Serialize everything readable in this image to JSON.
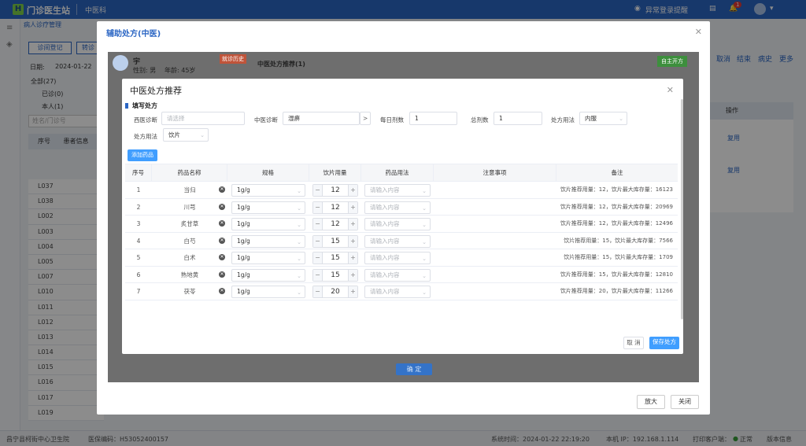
{
  "topbar": {
    "app_title": "门诊医生站",
    "department": "中医科",
    "anomaly_alert": "异常登录提醒",
    "notification_count": "1"
  },
  "background": {
    "breadcrumb": "病人诊疗管理",
    "register_button": "诊间登记",
    "transfer_button": "转诊",
    "date_label": "日期:",
    "date_value": "2024-01-22",
    "filter_all": "全部(27)",
    "filter_done": "已诊(0)",
    "filter_self": "本人(1)",
    "search_placeholder": "姓名/门诊号",
    "table_headers": [
      "序号",
      "患者信息"
    ],
    "rows": [
      "L037",
      "L038",
      "L002",
      "L003",
      "L004",
      "L005",
      "L007",
      "L010",
      "L011",
      "L012",
      "L013",
      "L014",
      "L015",
      "L016",
      "L017",
      "L019"
    ],
    "patient_name": "宇",
    "patient_gender": "性别: 男",
    "patient_age": "年龄: 45岁",
    "history_badge": "就诊历史",
    "recommend_title": "中医处方推荐(1)",
    "self_prescribe": "自主开方",
    "right_actions": [
      "取消",
      "结束",
      "病史",
      "更多"
    ],
    "op_header": "操作",
    "op_links": [
      "复用",
      "复用"
    ]
  },
  "outer_dialog": {
    "title": "辅助处方(中医)",
    "confirm_button": "确 定",
    "maximize_button": "放大",
    "close_button": "关闭"
  },
  "inner_dialog": {
    "title": "中医处方推荐",
    "section_title": "填写处方",
    "form": {
      "western_diag_label": "西医诊断",
      "western_diag_placeholder": "请选择",
      "tcm_diag_label": "中医诊断",
      "tcm_diag_value": "湿痹",
      "daily_doses_label": "每日剂数",
      "daily_doses_value": "1",
      "total_doses_label": "总剂数",
      "total_doses_value": "1",
      "usage_label": "处方用法",
      "usage_value": "内服",
      "usage2_label": "处方用法",
      "usage2_value": "饮片"
    },
    "add_drug_button": "添加药品",
    "columns": [
      "序号",
      "药品名称",
      "规格",
      "饮片用量",
      "药品用法",
      "注意事项",
      "备注"
    ],
    "usage_placeholder": "请输入内容",
    "drugs": [
      {
        "no": "1",
        "name": "当归",
        "spec": "1g/g",
        "qty": "12",
        "remark": "饮片推荐用量：12，饮片最大库存量：16123"
      },
      {
        "no": "2",
        "name": "川芎",
        "spec": "1g/g",
        "qty": "12",
        "remark": "饮片推荐用量：12，饮片最大库存量：20969"
      },
      {
        "no": "3",
        "name": "炙甘草",
        "spec": "1g/g",
        "qty": "12",
        "remark": "饮片推荐用量：12，饮片最大库存量：12496"
      },
      {
        "no": "4",
        "name": "白芍",
        "spec": "1g/g",
        "qty": "15",
        "remark": "饮片推荐用量：15，饮片最大库存量：7566"
      },
      {
        "no": "5",
        "name": "白术",
        "spec": "1g/g",
        "qty": "15",
        "remark": "饮片推荐用量：15，饮片最大库存量：1709"
      },
      {
        "no": "6",
        "name": "熟地黄",
        "spec": "1g/g",
        "qty": "15",
        "remark": "饮片推荐用量：15，饮片最大库存量：12810"
      },
      {
        "no": "7",
        "name": "茯苓",
        "spec": "1g/g",
        "qty": "20",
        "remark": "饮片推荐用量：20，饮片最大库存量：11266"
      }
    ],
    "cancel_button": "取 消",
    "save_button": "保存处方"
  },
  "statusbar": {
    "hospital": "昌宁县柯街中心卫生院",
    "insurance_code": "医保编码：H53052400157",
    "system_time": "系统时间：2024-01-22 22:19:20",
    "ip": "本机 IP：192.168.1.114",
    "print_client": "打印客户端：",
    "print_status": "正常",
    "version": "版本信息"
  },
  "colors": {
    "primary": "#2b66c4",
    "accent": "#409eff",
    "topbar": "#2b66c4"
  }
}
